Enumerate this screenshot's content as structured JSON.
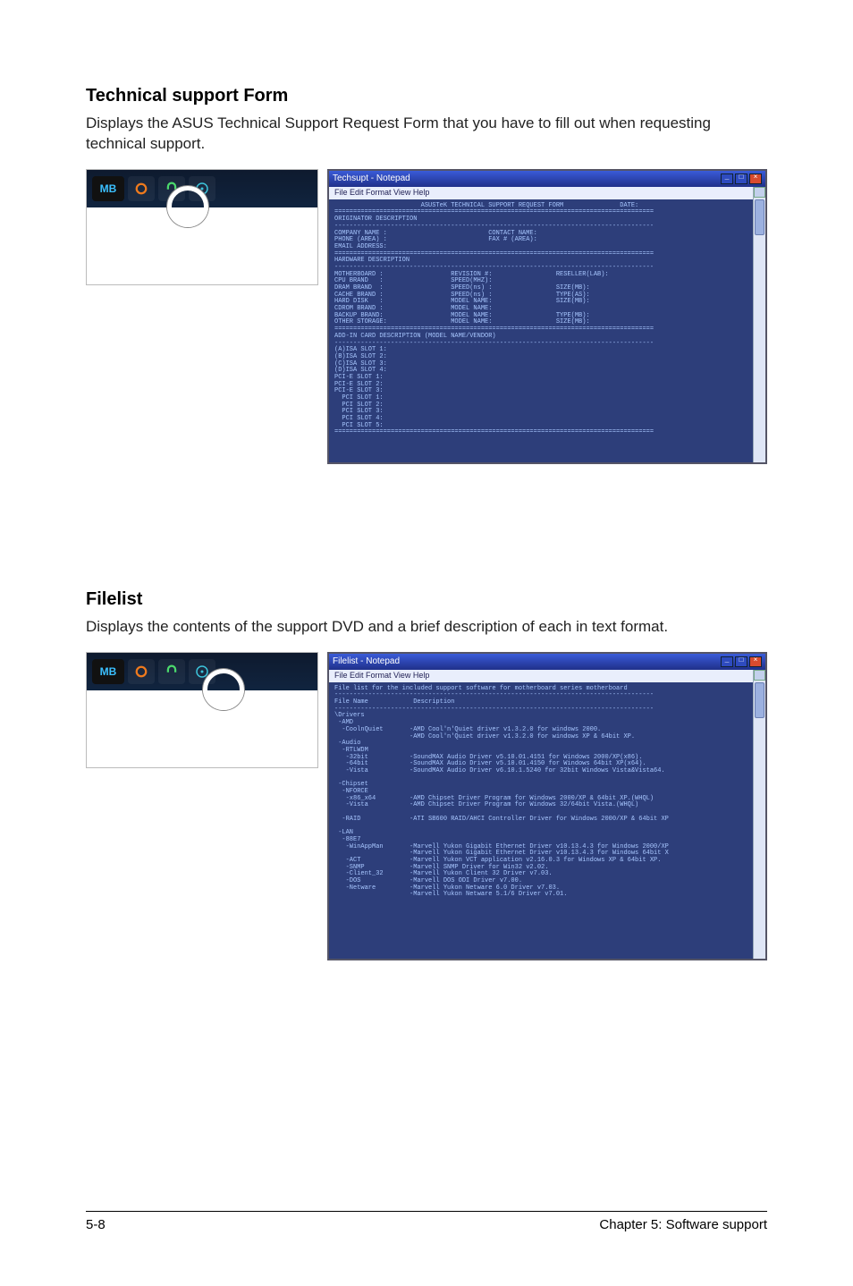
{
  "sections": {
    "tech": {
      "title": "Technical support Form",
      "desc": "Displays the ASUS Technical Support Request Form that you have to fill out when requesting technical support."
    },
    "filelist": {
      "title": "Filelist",
      "desc": "Displays the contents of the support DVD and a brief description of each in text format."
    }
  },
  "navbar": {
    "logo": "MB"
  },
  "panel_common": {
    "menubar": "File  Edit  Format  View  Help"
  },
  "panel1": {
    "win_title": "Techsupt - Notepad",
    "body": "                       ASUSTeK TECHNICAL SUPPORT REQUEST FORM               DATE:\n=====================================================================================\nORIGINATOR DESCRIPTION\n-------------------------------------------------------------------------------------\nCOMPANY NAME :                           CONTACT NAME:\nPHONE (AREA) :                           FAX # (AREA):\nEMAIL ADDRESS:\n=====================================================================================\nHARDWARE DESCRIPTION\n-------------------------------------------------------------------------------------\nMOTHERBOARD :                  REVISION #:                 RESELLER(LAB):\nCPU BRAND   :                  SPEED(MHZ):\nDRAM BRAND  :                  SPEED(ns) :                 SIZE(MB):\nCACHE BRAND :                  SPEED(ns) :                 TYPE(AS):\nHARD DISK   :                  MODEL NAME:                 SIZE(MB):\nCDROM BRAND :                  MODEL NAME:\nBACKUP BRAND:                  MODEL NAME:                 TYPE(MB):\nOTHER STORAGE:                 MODEL NAME:                 SIZE(MB):\n=====================================================================================\nADD-IN CARD DESCRIPTION (MODEL NAME/VENDOR)\n-------------------------------------------------------------------------------------\n(A)ISA SLOT 1:\n(B)ISA SLOT 2:\n(C)ISA SLOT 3:\n(D)ISA SLOT 4:\nPCI-E SLOT 1:\nPCI-E SLOT 2:\nPCI-E SLOT 3:\n  PCI SLOT 1:\n  PCI SLOT 2:\n  PCI SLOT 3:\n  PCI SLOT 4:\n  PCI SLOT 5:\n====================================================================================="
  },
  "panel2": {
    "win_title": "Filelist - Notepad",
    "body": "File list for the included support software for motherboard series motherboard\n-------------------------------------------------------------------------------------\nFile Name            Description\n-------------------------------------------------------------------------------------\n\\Drivers\n -AMD\n  -CoolnQuiet       -AMD Cool'n'Quiet driver v1.3.2.0 for windows 2000.\n                    -AMD Cool'n'Quiet driver v1.3.2.0 for windows XP & 64bit XP.\n -Audio\n  -RTLWDM\n   -32bit           -SoundMAX Audio Driver v5.10.01.4151 for Windows 2000/XP(x86).\n   -64bit           -SoundMAX Audio Driver v5.10.01.4150 for Windows 64bit XP(x64).\n   -Vista           -SoundMAX Audio Driver v6.10.1.5240 for 32bit Windows Vista&Vista64.\n\n -Chipset\n  -NFORCE\n   -x86_x64         -AMD Chipset Driver Program for Windows 2000/XP & 64bit XP.(WHQL)\n   -Vista           -AMD Chipset Driver Program for Windows 32/64bit Vista.(WHQL)\n\n  -RAID             -ATI SB600 RAID/AHCI Controller Driver for Windows 2000/XP & 64bit XP\n\n -LAN\n  -88E7\n   -WinAppMan       -Marvell Yukon Gigabit Ethernet Driver v10.13.4.3 for Windows 2000/XP\n                    -Marvell Yukon Gigabit Ethernet Driver v10.13.4.3 for Windows 64bit X\n   -ACT             -Marvell Yukon VCT application v2.16.0.3 for Windows XP & 64bit XP.\n   -SNMP            -Marvell SNMP Driver for Win32 v2.02.\n   -Client_32       -Marvell Yukon Client 32 Driver v7.03.\n   -DOS             -Marvell DOS ODI Driver v7.00.\n   -Netware         -Marvell Yukon Netware 6.0 Driver v7.03.\n                    -Marvell Yukon Netware 5.1/6 Driver v7.01."
  },
  "footer": {
    "left": "5-8",
    "right": "Chapter 5: Software support"
  }
}
